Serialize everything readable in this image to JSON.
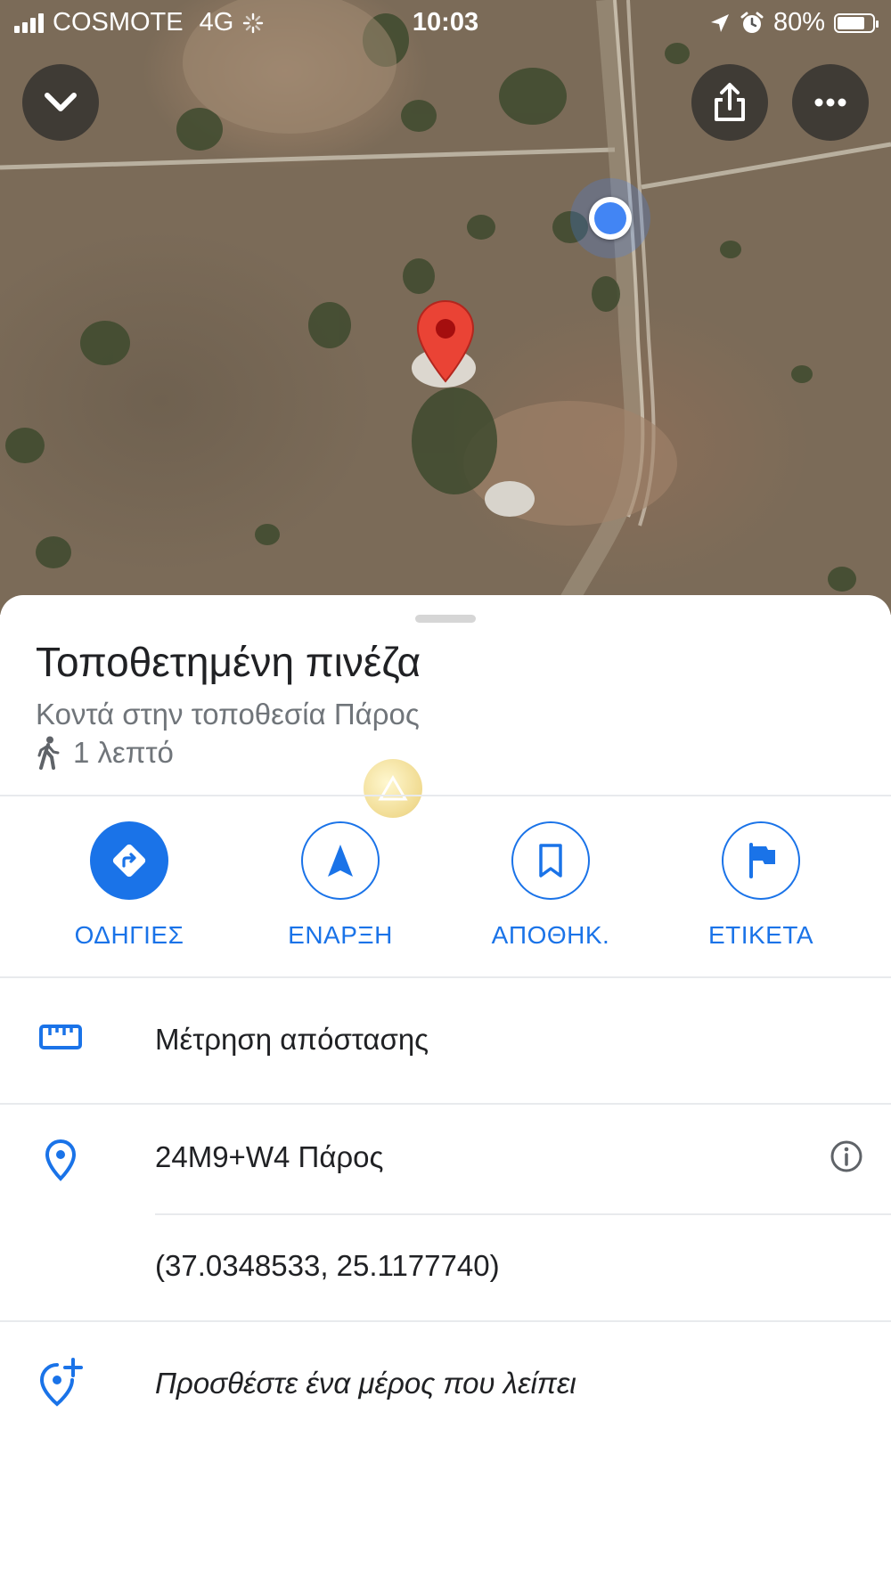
{
  "status_bar": {
    "carrier": "COSMOTE",
    "network": "4G",
    "time": "10:03",
    "battery_percent": "80%",
    "battery_level": 0.8
  },
  "map": {
    "close_icon": "chevron-down-icon",
    "share_icon": "share-icon",
    "more_icon": "more-horiz-icon"
  },
  "place": {
    "title": "Τοποθετημένη πινέζα",
    "subtitle": "Κοντά στην τοποθεσία Πάρος",
    "walk_time": "1 λεπτό"
  },
  "actions": [
    {
      "label": "ΟΔΗΓΙΕΣ",
      "icon": "directions-icon"
    },
    {
      "label": "ΕΝΑΡΞΗ",
      "icon": "navigation-arrow-icon"
    },
    {
      "label": "ΑΠΟΘΗΚ.",
      "icon": "bookmark-icon"
    },
    {
      "label": "ΕΤΙΚΕΤΑ",
      "icon": "flag-icon"
    }
  ],
  "details": {
    "measure_distance": "Μέτρηση απόστασης",
    "plus_code": "24M9+W4 Πάρος",
    "coordinates": "(37.0348533, 25.1177740)",
    "add_missing_place": "Προσθέστε ένα μέρος που λείπει"
  },
  "colors": {
    "accent": "#1a73e8",
    "pin": "#ea4335",
    "location_dot": "#4285f4"
  }
}
